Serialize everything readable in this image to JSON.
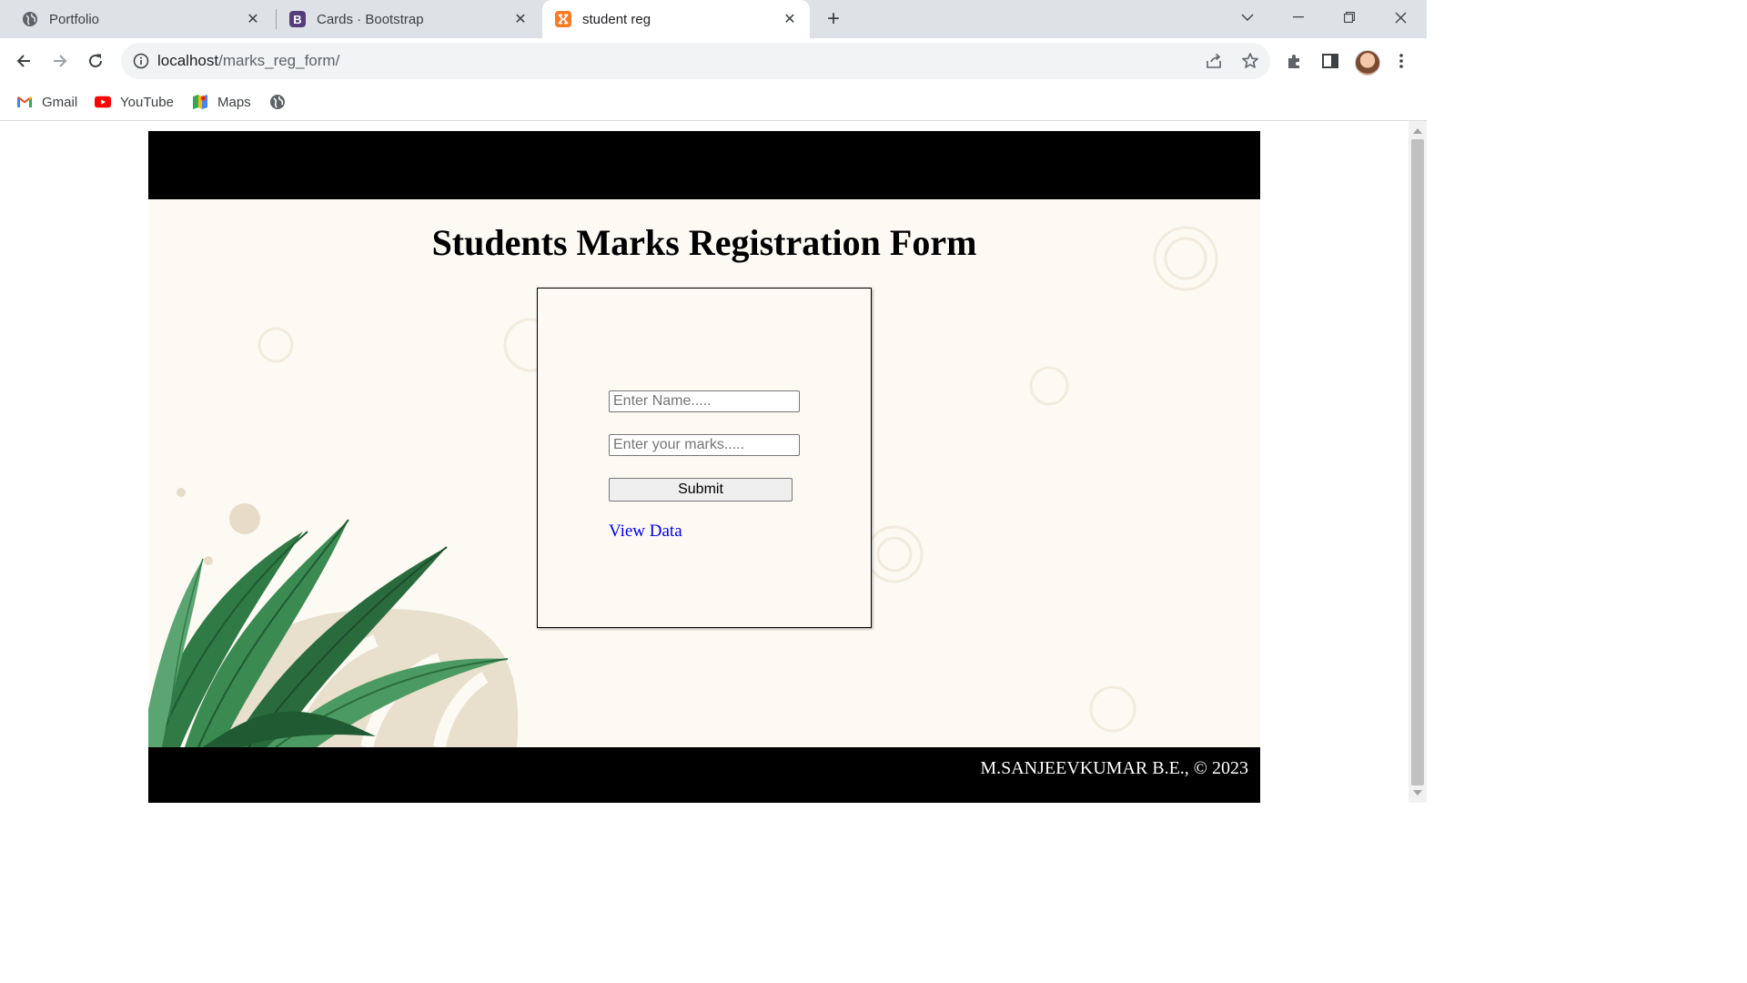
{
  "browser": {
    "tabs": [
      {
        "title": "Portfolio",
        "icon": "globe-icon",
        "active": false
      },
      {
        "title": "Cards · Bootstrap",
        "icon": "bootstrap-icon",
        "active": false
      },
      {
        "title": "student reg",
        "icon": "xampp-icon",
        "active": true
      }
    ],
    "url_host": "localhost",
    "url_path": "/marks_reg_form/",
    "bookmarks": [
      {
        "label": "Gmail",
        "icon": "gmail-icon"
      },
      {
        "label": "YouTube",
        "icon": "youtube-icon"
      },
      {
        "label": "Maps",
        "icon": "maps-icon"
      },
      {
        "label": "",
        "icon": "globe-icon"
      }
    ]
  },
  "page": {
    "heading": "Students Marks Registration Form",
    "form": {
      "name_placeholder": "Enter Name.....",
      "marks_placeholder": "Enter your marks.....",
      "submit_label": "Submit",
      "view_link": "View Data"
    },
    "footer": "M.SANJEEVKUMAR B.E., © 2023"
  },
  "colors": {
    "header_bg": "#000000",
    "body_bg": "#fdfaf3",
    "link": "#0000ee",
    "leaf_green": "#2f7a45",
    "leaf_beige": "#e6dcc8"
  }
}
